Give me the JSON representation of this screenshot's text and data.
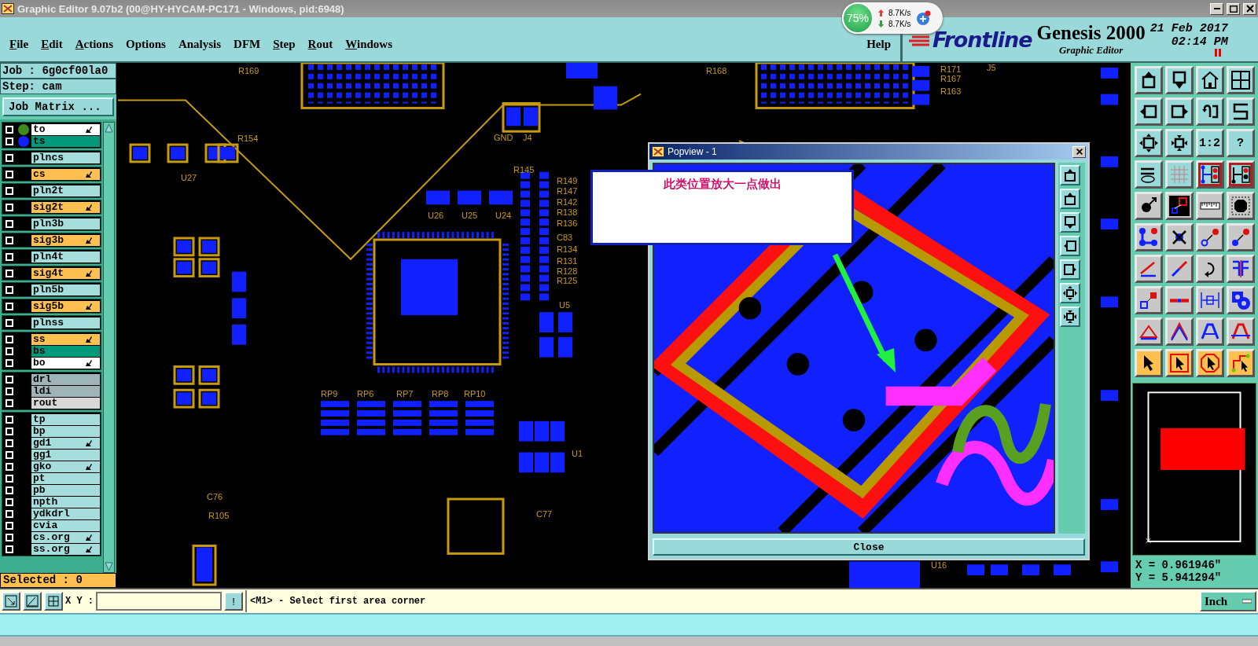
{
  "window": {
    "title": "Graphic Editor 9.07b2 (00@HY-HYCAM-PC171 - Windows, pid:6948)"
  },
  "network_widget": {
    "percent": "75%",
    "upload": "8.7K/s",
    "download": "8.7K/s"
  },
  "menu": [
    {
      "label": "File",
      "mnemonic": true
    },
    {
      "label": "Edit",
      "mnemonic": true
    },
    {
      "label": "Actions",
      "mnemonic": true
    },
    {
      "label": "Options",
      "mnemonic": false
    },
    {
      "label": "Analysis",
      "mnemonic": false
    },
    {
      "label": "DFM",
      "mnemonic": false
    },
    {
      "label": "Step",
      "mnemonic": true
    },
    {
      "label": "Rout",
      "mnemonic": true
    },
    {
      "label": "Windows",
      "mnemonic": true
    },
    {
      "label": "Help",
      "mnemonic": false
    }
  ],
  "brand": {
    "logo": "Frontline",
    "product": "Genesis 2000",
    "subtitle": "Graphic Editor",
    "date": "21 Feb 2017",
    "time": "02:14 PM"
  },
  "job": {
    "job": "Job : 6g0cf00la0",
    "step": "Step: cam",
    "matrix_button": "Job Matrix ..."
  },
  "layer_groups": [
    {
      "layers": [
        {
          "name": "to",
          "color": "#ffffff",
          "editable": true,
          "checked": false,
          "dot": {
            "color": "#3c8c1e"
          }
        },
        {
          "name": "ts",
          "color": "#00997a",
          "editable": false,
          "checked": false,
          "dot": {
            "color": "#1020ff"
          }
        }
      ]
    },
    {
      "layers": [
        {
          "name": "plncs",
          "color": "#a6dede",
          "editable": false,
          "checked": false
        }
      ]
    },
    {
      "layers": [
        {
          "name": "cs",
          "color": "#ffc050",
          "editable": true,
          "checked": false
        }
      ]
    },
    {
      "layers": [
        {
          "name": "pln2t",
          "color": "#a6dede",
          "editable": false,
          "checked": false
        }
      ]
    },
    {
      "layers": [
        {
          "name": "sig2t",
          "color": "#ffc050",
          "editable": true,
          "checked": false
        }
      ]
    },
    {
      "layers": [
        {
          "name": "pln3b",
          "color": "#a6dede",
          "editable": false,
          "checked": false
        }
      ]
    },
    {
      "layers": [
        {
          "name": "sig3b",
          "color": "#ffc050",
          "editable": true,
          "checked": false
        }
      ]
    },
    {
      "layers": [
        {
          "name": "pln4t",
          "color": "#a6dede",
          "editable": false,
          "checked": false
        }
      ]
    },
    {
      "layers": [
        {
          "name": "sig4t",
          "color": "#ffc050",
          "editable": true,
          "checked": false
        }
      ]
    },
    {
      "layers": [
        {
          "name": "pln5b",
          "color": "#a6dede",
          "editable": false,
          "checked": false
        }
      ]
    },
    {
      "layers": [
        {
          "name": "sig5b",
          "color": "#ffc050",
          "editable": true,
          "checked": false
        }
      ]
    },
    {
      "layers": [
        {
          "name": "plnss",
          "color": "#a6dede",
          "editable": false,
          "checked": false
        }
      ]
    },
    {
      "layers": [
        {
          "name": "ss",
          "color": "#ffc050",
          "editable": true,
          "checked": false
        },
        {
          "name": "bs",
          "color": "#00997a",
          "editable": false,
          "checked": false
        },
        {
          "name": "bo",
          "color": "#ffffff",
          "editable": true,
          "checked": false
        }
      ]
    },
    {
      "layers": [
        {
          "name": "drl",
          "color": "#9fb4b8",
          "editable": false,
          "checked": false
        },
        {
          "name": "ldi",
          "color": "#9fb4b8",
          "editable": false,
          "checked": false
        },
        {
          "name": "rout",
          "color": "#d8d8d8",
          "editable": false,
          "checked": false
        }
      ]
    },
    {
      "layers": [
        {
          "name": "tp",
          "color": "#a6dede",
          "editable": false,
          "checked": false
        },
        {
          "name": "bp",
          "color": "#a6dede",
          "editable": false,
          "checked": false
        },
        {
          "name": "gd1",
          "color": "#a6dede",
          "editable": true,
          "checked": false
        },
        {
          "name": "gg1",
          "color": "#a6dede",
          "editable": false,
          "checked": false
        },
        {
          "name": "gko",
          "color": "#a6dede",
          "editable": true,
          "checked": false
        },
        {
          "name": "pt",
          "color": "#a6dede",
          "editable": false,
          "checked": false
        },
        {
          "name": "pb",
          "color": "#a6dede",
          "editable": false,
          "checked": false
        },
        {
          "name": "npth",
          "color": "#a6dede",
          "editable": false,
          "checked": false
        },
        {
          "name": "ydkdrl",
          "color": "#a6dede",
          "editable": false,
          "checked": false
        },
        {
          "name": "cvia",
          "color": "#a6dede",
          "editable": false,
          "checked": false
        },
        {
          "name": "cs.org",
          "color": "#a6dede",
          "editable": true,
          "checked": false
        },
        {
          "name": "ss.org",
          "color": "#a6dede",
          "editable": true,
          "checked": false
        }
      ]
    }
  ],
  "selected_count": "Selected : 0",
  "canvas": {
    "labels": [
      "R169",
      "R168",
      "R171",
      "J5",
      "R167",
      "R163",
      "R154",
      "GND",
      "J4",
      "U27",
      "R145",
      "R149",
      "R147",
      "R142",
      "U26",
      "U25",
      "U24",
      "R138",
      "R136",
      "C83",
      "R134",
      "R131",
      "R128",
      "R125",
      "U5",
      "RP9",
      "RP6",
      "RP7",
      "RP8",
      "RP10",
      "U1",
      "C76",
      "R105",
      "C77",
      "U16"
    ]
  },
  "popview": {
    "title": "Popview - 1",
    "note": "此类位置放大一点做出",
    "close": "Close"
  },
  "tool_rows": [
    {
      "kind": "teal",
      "tools": [
        {
          "selected": false
        },
        {
          "selected": false
        },
        {
          "selected": false
        },
        {
          "selected": false
        }
      ]
    },
    {
      "kind": "teal",
      "tools": [
        {
          "selected": false
        },
        {
          "selected": false
        },
        {
          "selected": false
        },
        {
          "selected": false
        }
      ]
    },
    {
      "kind": "teal",
      "tools": [
        {
          "selected": false
        },
        {
          "selected": false
        },
        {
          "selected": false,
          "label": "1:2"
        },
        {
          "selected": false,
          "label": "?"
        }
      ]
    },
    {
      "kind": "teal",
      "tools": [
        {
          "selected": false
        },
        {
          "selected": false
        },
        {
          "selected": true
        },
        {
          "selected": true
        }
      ]
    },
    {
      "kind": "grey",
      "tools": [
        {
          "selected": false
        },
        {
          "selected": false
        },
        {
          "selected": false
        },
        {
          "selected": false
        }
      ]
    },
    {
      "kind": "grey",
      "tools": [
        {
          "selected": false
        },
        {
          "selected": false
        },
        {
          "selected": false
        },
        {
          "selected": false
        }
      ]
    },
    {
      "kind": "grey",
      "tools": [
        {
          "selected": false
        },
        {
          "selected": false
        },
        {
          "selected": false
        },
        {
          "selected": false
        }
      ]
    },
    {
      "kind": "grey",
      "tools": [
        {
          "selected": false
        },
        {
          "selected": false
        },
        {
          "selected": false
        },
        {
          "selected": false
        }
      ]
    },
    {
      "kind": "grey",
      "tools": [
        {
          "selected": false
        },
        {
          "selected": false
        },
        {
          "selected": false
        },
        {
          "selected": false
        }
      ]
    },
    {
      "kind": "orange",
      "tools": [
        {
          "selected": false
        },
        {
          "selected": false
        },
        {
          "selected": false
        },
        {
          "selected": false
        }
      ]
    }
  ],
  "coords": {
    "x": "X = 0.961946\"",
    "y": "Y = 5.941294\""
  },
  "command_bar": {
    "xy_label": "X Y :",
    "bang": "!",
    "prompt": "<M1> - Select first area corner",
    "units": "Inch"
  }
}
